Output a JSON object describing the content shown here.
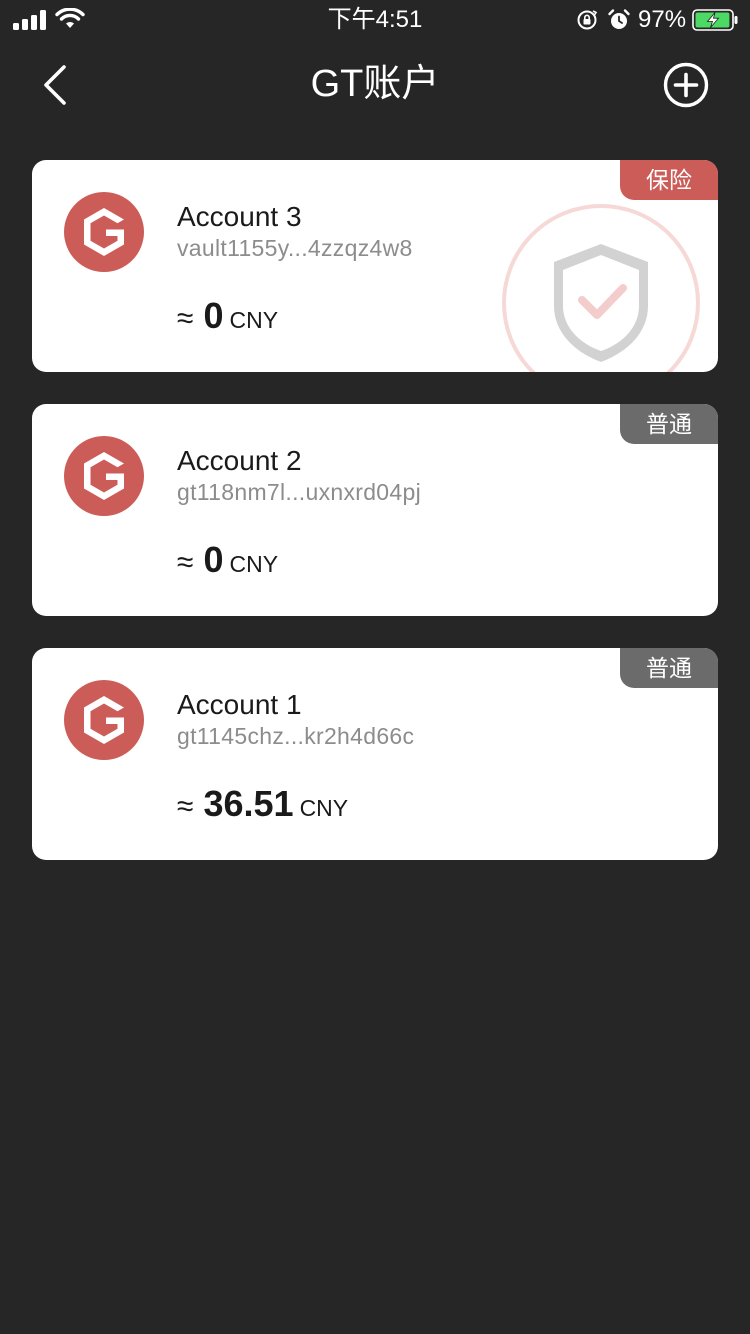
{
  "status_bar": {
    "time": "下午4:51",
    "battery_percent": "97%",
    "battery_level": 0.97
  },
  "nav": {
    "title": "GT账户",
    "back_icon": "chevron-left-icon",
    "add_icon": "plus-circle-icon"
  },
  "colors": {
    "background": "#262626",
    "brand_red": "#cc5c58",
    "badge_insured": "#cc5c58",
    "badge_normal": "#6b6b6b"
  },
  "accounts": [
    {
      "name": "Account 3",
      "address": "vault1155y...4zzqz4w8",
      "approx_symbol": "≈",
      "amount": "0",
      "currency": "CNY",
      "badge": "保险",
      "badge_type": "insured",
      "watermark_icon": "shield-check-icon"
    },
    {
      "name": "Account 2",
      "address": "gt118nm7l...uxnxrd04pj",
      "approx_symbol": "≈",
      "amount": "0",
      "currency": "CNY",
      "badge": "普通",
      "badge_type": "normal"
    },
    {
      "name": "Account 1",
      "address": "gt1145chz...kr2h4d66c",
      "approx_symbol": "≈",
      "amount": "36.51",
      "currency": "CNY",
      "badge": "普通",
      "badge_type": "normal"
    }
  ]
}
